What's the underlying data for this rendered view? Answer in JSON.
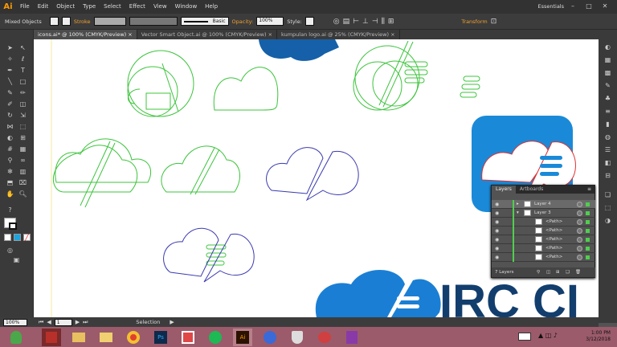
{
  "app": {
    "logo": "Ai",
    "workspace": "Essentials"
  },
  "menu": [
    "File",
    "Edit",
    "Object",
    "Type",
    "Select",
    "Effect",
    "View",
    "Window",
    "Help"
  ],
  "control": {
    "selection": "Mixed Objects",
    "stroke_label": "Stroke",
    "brush": "Basic",
    "opacity_label": "Opacity:",
    "opacity_value": "100%",
    "style_label": "Style:",
    "transform_label": "Transform"
  },
  "tabs": [
    {
      "label": "icons.ai* @ 100% (CMYK/Preview)",
      "close": "×"
    },
    {
      "label": "Vector Smart Object.ai @ 100% (CMYK/Preview)",
      "close": "×"
    },
    {
      "label": "kumpulan logo.ai @ 25% (CMYK/Preview)",
      "close": "×"
    }
  ],
  "status": {
    "zoom": "100%",
    "page": "1",
    "tool": "Selection"
  },
  "canvas": {
    "brand_text": "IRC CI"
  },
  "layers_panel": {
    "tabs": [
      "Layers",
      "Artboards"
    ],
    "rows": [
      "Layer 4",
      "Layer 3",
      "<Path>",
      "<Path>",
      "<Path>",
      "<Path>",
      "<Path>"
    ],
    "count": "7 Layers"
  },
  "clock": {
    "time": "1:00 PM",
    "date": "3/12/2018"
  },
  "colors": {
    "accent": "#ff9a00",
    "guide_green": "#3cc43c",
    "guide_blue": "#3a3ab0",
    "brand_blue": "#1a7fd4",
    "selection_red": "#e03030"
  }
}
